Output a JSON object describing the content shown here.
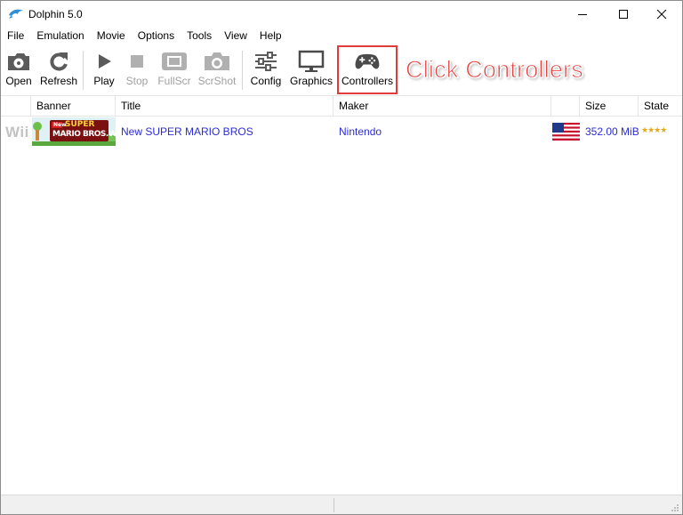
{
  "window": {
    "title": "Dolphin 5.0",
    "icon": "dolphin-icon",
    "controls": [
      "minimize-icon",
      "maximize-icon",
      "close-icon"
    ]
  },
  "menu": [
    "File",
    "Emulation",
    "Movie",
    "Options",
    "Tools",
    "View",
    "Help"
  ],
  "toolbar": {
    "open": {
      "label": "Open",
      "icon": "open-disc-icon"
    },
    "refresh": {
      "label": "Refresh",
      "icon": "refresh-icon"
    },
    "play": {
      "label": "Play",
      "icon": "play-icon"
    },
    "stop": {
      "label": "Stop",
      "icon": "stop-icon",
      "enabled": false
    },
    "fullscr": {
      "label": "FullScr",
      "icon": "fullscreen-icon",
      "enabled": false
    },
    "scrshot": {
      "label": "ScrShot",
      "icon": "camera-icon",
      "enabled": false
    },
    "config": {
      "label": "Config",
      "icon": "sliders-icon"
    },
    "graphics": {
      "label": "Graphics",
      "icon": "monitor-icon"
    },
    "controllers": {
      "label": "Controllers",
      "icon": "gamepad-icon"
    }
  },
  "annotation": {
    "text": "Click Controllers",
    "color": "#e8403f"
  },
  "columns": {
    "platform": "",
    "banner": "Banner",
    "title": "Title",
    "maker": "Maker",
    "region": "",
    "size": "Size",
    "state": "State"
  },
  "games": [
    {
      "platform": "Wii",
      "banner_text_top": "New",
      "banner_text_main": "SUPER",
      "banner_text_sub": "MARIO BROS.Wii",
      "title": "New SUPER MARIO BROS",
      "maker": "Nintendo",
      "region": "usa-flag-icon",
      "size": "352.00 MiB",
      "state": "★★★★",
      "state_rating": 4
    }
  ],
  "status": {
    "left": "",
    "right": ""
  }
}
